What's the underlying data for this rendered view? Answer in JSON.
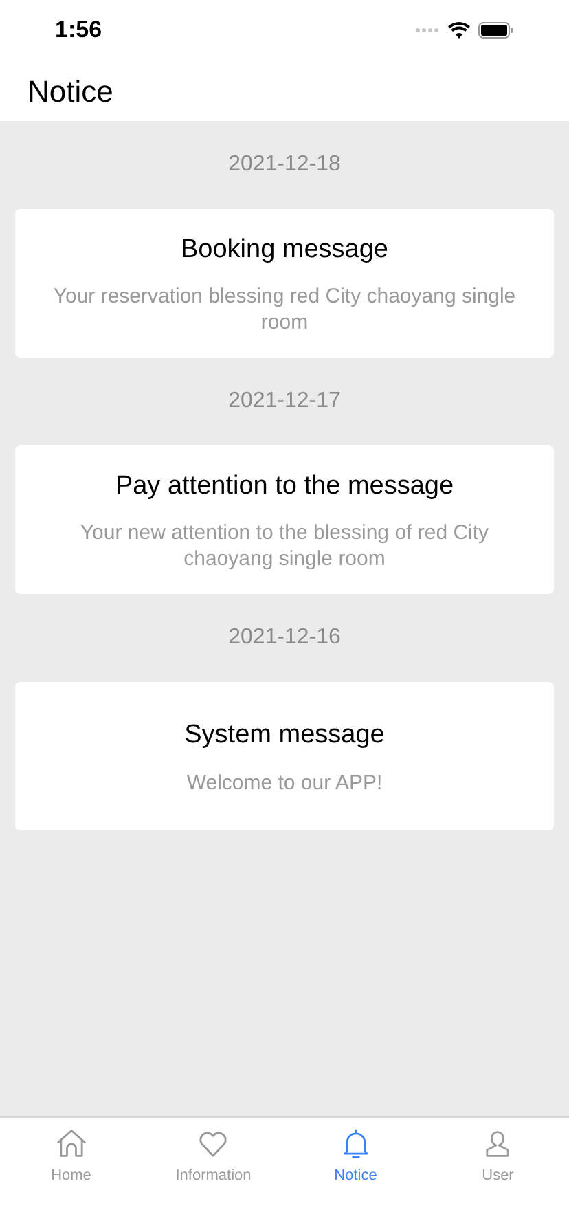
{
  "status_bar": {
    "time": "1:56"
  },
  "header": {
    "title": "Notice"
  },
  "notices": [
    {
      "date": "2021-12-18",
      "title": "Booking message",
      "body": "Your reservation blessing red City chaoyang single room"
    },
    {
      "date": "2021-12-17",
      "title": "Pay attention to the message",
      "body": "Your new attention to the blessing of red City chaoyang single room"
    },
    {
      "date": "2021-12-16",
      "title": "System message",
      "body": "Welcome to our APP!"
    }
  ],
  "tab_bar": [
    {
      "kind": "home",
      "label": "Home",
      "selected": false
    },
    {
      "kind": "heart",
      "label": "Information",
      "selected": false
    },
    {
      "kind": "bell",
      "label": "Notice",
      "selected": true
    },
    {
      "kind": "user",
      "label": "User",
      "selected": false
    }
  ]
}
